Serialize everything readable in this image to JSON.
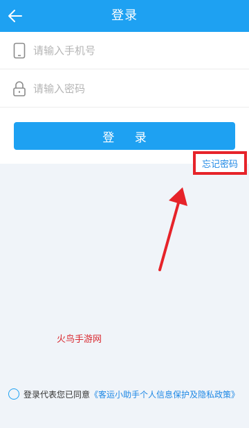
{
  "header": {
    "title": "登录",
    "back_icon": "arrow-left-icon"
  },
  "form": {
    "phone_placeholder": "请输入手机号",
    "phone_icon": "phone-icon",
    "password_placeholder": "请输入密码",
    "password_icon": "lock-icon",
    "login_label": "登 录",
    "forgot_label": "忘记密码"
  },
  "watermark": "火鸟手游网",
  "agreement": {
    "text": "登录代表您已同意",
    "link": "《客运小助手个人信息保护及隐私政策》"
  },
  "colors": {
    "primary": "#1ea1f2",
    "link": "#1e88e5",
    "annotation_red": "#e6232a",
    "background": "#f0f4f9"
  }
}
